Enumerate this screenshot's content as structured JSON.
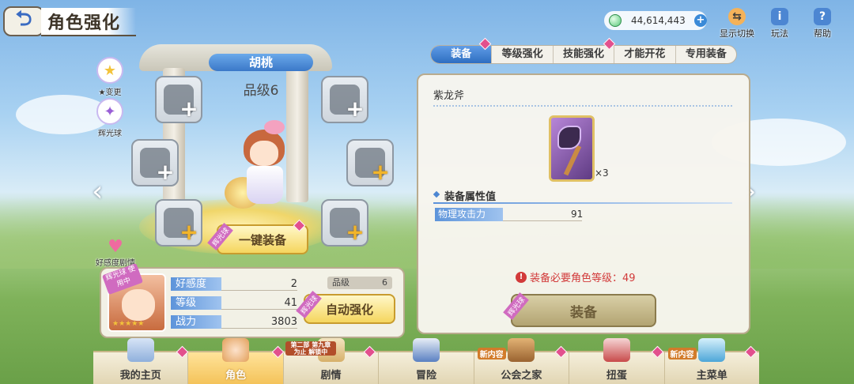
{
  "header": {
    "back_symbol": "⮌",
    "title": "角色强化",
    "currency_value": "44,614,443"
  },
  "top_tools": [
    {
      "label": "显示切换",
      "icon": "swap-display-icon"
    },
    {
      "label": "玩法",
      "icon": "info-icon",
      "glyph": "i"
    },
    {
      "label": "帮助",
      "icon": "help-icon",
      "glyph": "?"
    }
  ],
  "side_buttons": [
    {
      "label": "★变更",
      "icon": "star-change-icon",
      "glyph": "★"
    },
    {
      "label": "辉光球",
      "icon": "glow-orb-icon",
      "glyph": "✦"
    }
  ],
  "character": {
    "name": "胡桃",
    "rank": "品级6",
    "one_key_equip": "一键装备",
    "ribbon": "辉光球"
  },
  "affection_label": "好感度剧情",
  "stats": {
    "portrait_badge": "辉光球 使用中",
    "rows": [
      {
        "label": "好感度",
        "value": "2"
      },
      {
        "label": "等级",
        "value": "41"
      },
      {
        "label": "战力",
        "value": "3803"
      }
    ],
    "rank_label": "品级",
    "rank_value": "6",
    "auto_enhance": "自动强化",
    "auto_ribbon": "辉光球"
  },
  "tabs": [
    {
      "label": "装备",
      "active": true
    },
    {
      "label": "等级强化",
      "active": false
    },
    {
      "label": "技能强化",
      "active": false
    },
    {
      "label": "才能开花",
      "active": false
    },
    {
      "label": "专用装备",
      "active": false
    }
  ],
  "detail": {
    "item_name": "紫龙斧",
    "item_count": "×3",
    "section_title": "装备属性值",
    "attr_label": "物理攻击力",
    "attr_value": "91",
    "warning": "装备必要角色等级：49",
    "equip_button": "装备",
    "equip_ribbon": "辉光球"
  },
  "bottom_nav": [
    {
      "label": "我的主页",
      "badge": ""
    },
    {
      "label": "角色",
      "badge": "",
      "active": true
    },
    {
      "label": "剧情",
      "badge": "第二部 第九章为止 解锁中"
    },
    {
      "label": "冒险",
      "badge": ""
    },
    {
      "label": "公会之家",
      "badge": "新内容"
    },
    {
      "label": "扭蛋",
      "badge": ""
    },
    {
      "label": "主菜单",
      "badge": "新内容"
    }
  ],
  "colors": {
    "accent_blue": "#3b78c8",
    "gold_button": "#f5d65e",
    "warning_red": "#d23a3a",
    "ribbon_purple": "#d06bc0"
  }
}
